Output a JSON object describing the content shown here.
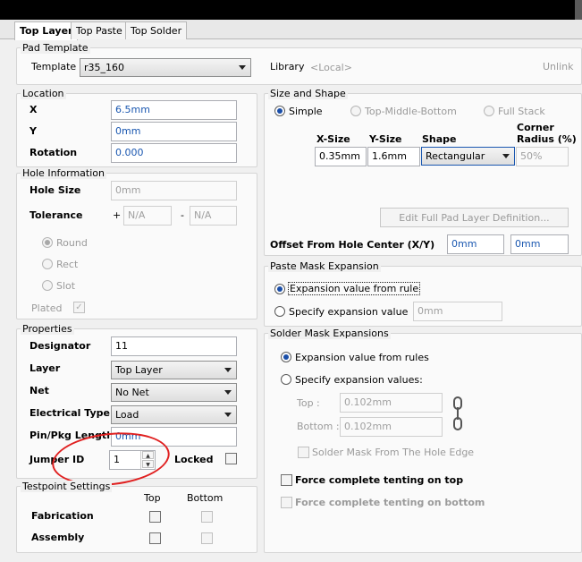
{
  "tabs": [
    "Top Layer",
    "Top Paste",
    "Top Solder"
  ],
  "pad_template": {
    "title": "Pad Template",
    "template_label": "Template",
    "template_value": "r35_160",
    "library_label": "Library",
    "library_value": "<Local>",
    "unlink_label": "Unlink"
  },
  "location": {
    "title": "Location",
    "x_label": "X",
    "x_value": "6.5mm",
    "y_label": "Y",
    "y_value": "0mm",
    "rotation_label": "Rotation",
    "rotation_value": "0.000"
  },
  "hole": {
    "title": "Hole Information",
    "size_label": "Hole Size",
    "size_value": "0mm",
    "tolerance_label": "Tolerance",
    "plus": "+",
    "plus_value": "N/A",
    "minus": "-",
    "minus_value": "N/A",
    "round_label": "Round",
    "rect_label": "Rect",
    "slot_label": "Slot",
    "plated_label": "Plated"
  },
  "properties": {
    "title": "Properties",
    "designator_label": "Designator",
    "designator_value": "11",
    "layer_label": "Layer",
    "layer_value": "Top Layer",
    "net_label": "Net",
    "net_value": "No Net",
    "etype_label": "Electrical Type",
    "etype_value": "Load",
    "pinpkg_label": "Pin/Pkg Length",
    "pinpkg_value": "0mm",
    "jumper_label": "Jumper ID",
    "jumper_value": "1",
    "locked_label": "Locked"
  },
  "testpoint": {
    "title": "Testpoint Settings",
    "top_header": "Top",
    "bottom_header": "Bottom",
    "fabrication_label": "Fabrication",
    "assembly_label": "Assembly"
  },
  "size_shape": {
    "title": "Size and Shape",
    "simple_label": "Simple",
    "tmb_label": "Top-Middle-Bottom",
    "fullstack_label": "Full Stack",
    "xsize_header": "X-Size",
    "ysize_header": "Y-Size",
    "shape_header": "Shape",
    "corner_header_1": "Corner",
    "corner_header_2": "Radius (%)",
    "xsize_value": "0.35mm",
    "ysize_value": "1.6mm",
    "shape_value": "Rectangular",
    "corner_value": "50%",
    "edit_button": "Edit Full Pad Layer Definition...",
    "offset_label": "Offset From Hole Center (X/Y)",
    "offset_x": "0mm",
    "offset_y": "0mm"
  },
  "paste_mask": {
    "title": "Paste Mask Expansion",
    "rule_label": "Expansion value from rule",
    "specify_label": "Specify expansion value",
    "specify_value": "0mm"
  },
  "solder_mask": {
    "title": "Solder Mask Expansions",
    "rules_label": "Expansion value from rules",
    "specify_label": "Specify expansion values:",
    "top_label": "Top :",
    "top_value": "0.102mm",
    "bottom_label": "Bottom :",
    "bottom_value": "0.102mm",
    "from_hole_label": "Solder Mask From The Hole Edge",
    "tent_top_label": "Force complete tenting on top",
    "tent_bottom_label": "Force complete tenting on bottom"
  },
  "colors": {
    "value_blue": "#1a57b0",
    "annotation_red": "#e02020"
  }
}
